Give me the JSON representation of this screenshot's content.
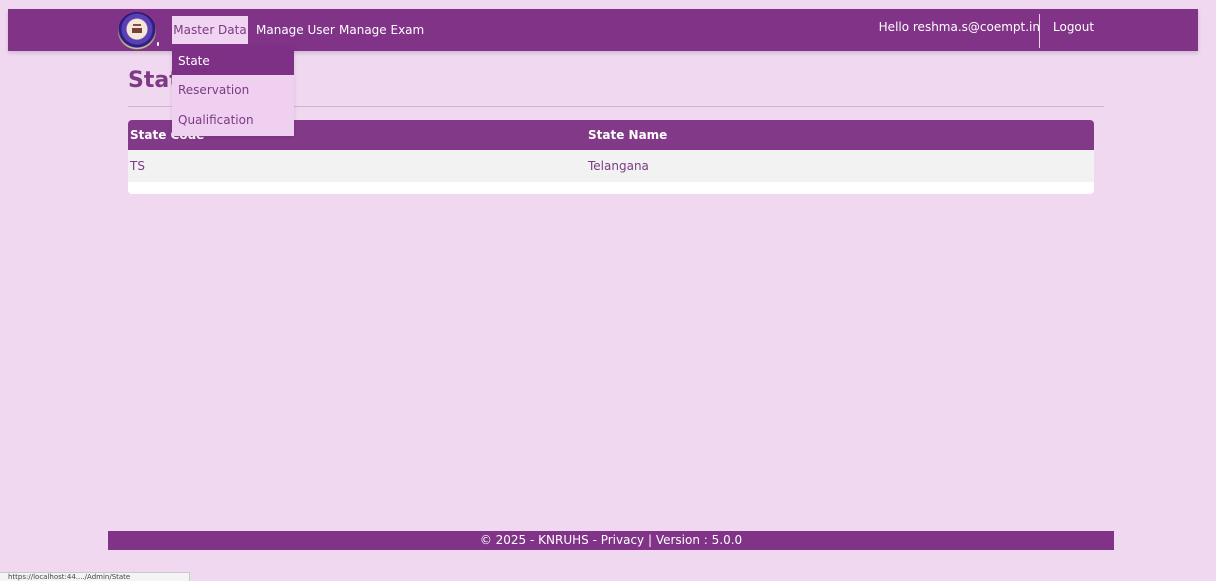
{
  "nav": {
    "master_data": "Master Data",
    "manage_user": "Manage User",
    "manage_exam": "Manage Exam",
    "greeting": "Hello reshma.s@coempt.in",
    "logout": "Logout"
  },
  "dropdown": {
    "items": [
      {
        "label": "State"
      },
      {
        "label": "Reservation"
      },
      {
        "label": "Qualification"
      }
    ]
  },
  "page": {
    "title": "Stat"
  },
  "table": {
    "headers": [
      "State Code",
      "State Name"
    ],
    "rows": [
      [
        "TS",
        "Telangana"
      ]
    ]
  },
  "footer": {
    "text": "© 2025 - KNRUHS - Privacy | Version : 5.0.0"
  },
  "status_bar": {
    "link": "https://localhost:44..../Admin/State"
  },
  "colors": {
    "primary": "#813388",
    "background": "#f0d8f0",
    "accent_text": "#7d3a84"
  },
  "icons": {
    "logo": "university-seal-logo"
  }
}
